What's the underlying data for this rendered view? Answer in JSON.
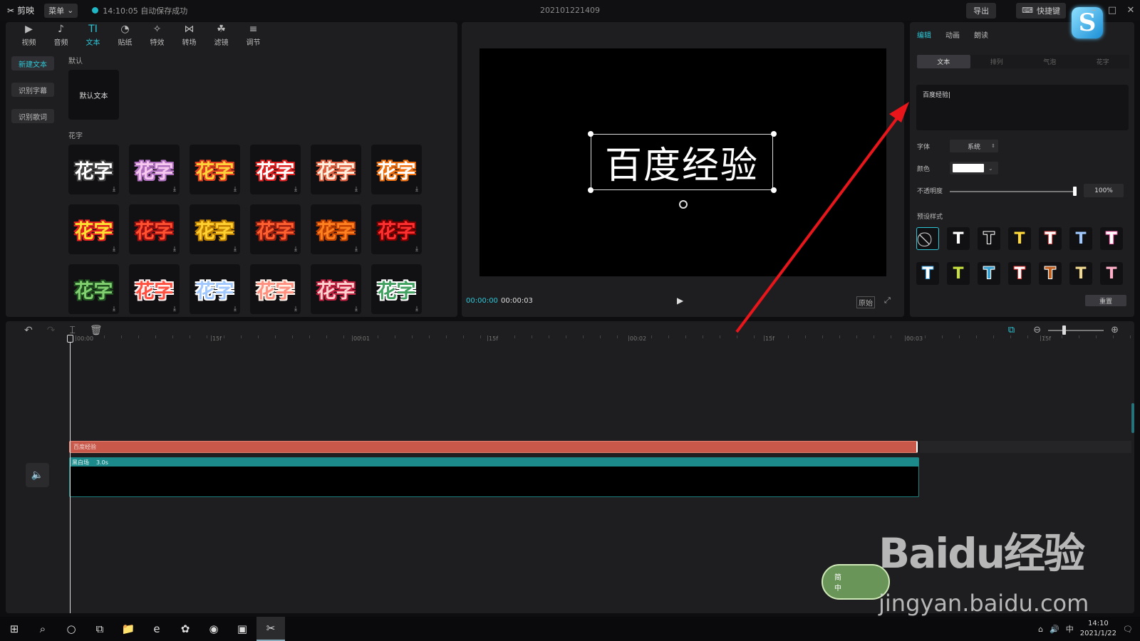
{
  "titlebar": {
    "app_name": "剪映",
    "menu_label": "菜单",
    "autosave": "14:10:05 自动保存成功",
    "project_title": "202101221409",
    "export_label": "导出",
    "shortcut_label": "快捷键"
  },
  "toolbar": {
    "items": [
      {
        "label": "视频",
        "icon": "▶"
      },
      {
        "label": "音频",
        "icon": "♪"
      },
      {
        "label": "文本",
        "icon": "TI"
      },
      {
        "label": "贴纸",
        "icon": "◔"
      },
      {
        "label": "特效",
        "icon": "✧"
      },
      {
        "label": "转场",
        "icon": "⋈"
      },
      {
        "label": "滤镜",
        "icon": "☘"
      },
      {
        "label": "调节",
        "icon": "≡"
      }
    ]
  },
  "sidebar": {
    "items": [
      "新建文本",
      "识别字幕",
      "识别歌词"
    ]
  },
  "library": {
    "default_section": "默认",
    "default_card": "默认文本",
    "huazi_section": "花字",
    "huazi": [
      {
        "label": "花字",
        "color": "#ffffff",
        "stroke": "#444444"
      },
      {
        "label": "花字",
        "color": "#f6c8f0",
        "stroke": "#b070c0"
      },
      {
        "label": "花字",
        "color": "#ffd23a",
        "stroke": "#e04020"
      },
      {
        "label": "花字",
        "color": "#ffffff",
        "stroke": "#e02020"
      },
      {
        "label": "花字",
        "color": "#fff0e0",
        "stroke": "#e06040"
      },
      {
        "label": "花字",
        "color": "#ffffff",
        "stroke": "#f07010"
      },
      {
        "label": "花字",
        "color": "#ffe030",
        "stroke": "#e02020"
      },
      {
        "label": "花字",
        "color": "#ff5030",
        "stroke": "#a01010"
      },
      {
        "label": "花字",
        "color": "#ffd030",
        "stroke": "#c08000"
      },
      {
        "label": "花字",
        "color": "#ff6030",
        "stroke": "#a02010"
      },
      {
        "label": "花字",
        "color": "#ff8020",
        "stroke": "#c04000"
      },
      {
        "label": "花字",
        "color": "#ff3030",
        "stroke": "#800000"
      },
      {
        "label": "花字",
        "color": "#80d070",
        "stroke": "#205020"
      },
      {
        "label": "花字",
        "color": "#ff5040",
        "stroke": "#fff0f0"
      },
      {
        "label": "花字",
        "color": "#a0c8ff",
        "stroke": "#ffffff"
      },
      {
        "label": "花字",
        "color": "#ff9080",
        "stroke": "#fff0e8"
      },
      {
        "label": "花字",
        "color": "#ffd0d0",
        "stroke": "#c02040"
      },
      {
        "label": "花字",
        "color": "#40a060",
        "stroke": "#ffffff"
      }
    ]
  },
  "preview": {
    "canvas_text": "百度经验",
    "time_current": "00:00:00",
    "time_total": "00:00:03",
    "ratio_label": "原始"
  },
  "inspector": {
    "tabs": [
      "编辑",
      "动画",
      "朗读"
    ],
    "subtabs": [
      "文本",
      "排列",
      "气泡",
      "花字"
    ],
    "text_value": "百度经验",
    "font_label": "字体",
    "font_value": "系统",
    "color_label": "颜色",
    "color_value": "#ffffff",
    "opacity_label": "不透明度",
    "opacity_value": "100%",
    "opacity_level": 1.0,
    "preset_label": "预设样式",
    "reset_label": "重置",
    "presets": [
      {
        "label": "⃠",
        "color": "#cccccc",
        "stroke": "#111113"
      },
      {
        "label": "T",
        "color": "#ffffff",
        "stroke": "#111113"
      },
      {
        "label": "T",
        "color": "#111113",
        "stroke": "#ffffff"
      },
      {
        "label": "T",
        "color": "#ffd83a",
        "stroke": "#111113"
      },
      {
        "label": "T",
        "color": "#ffffff",
        "stroke": "#e05050"
      },
      {
        "label": "T",
        "color": "#9fc8ff",
        "stroke": "#111113"
      },
      {
        "label": "T",
        "color": "#ffffff",
        "stroke": "#ff69b4"
      },
      {
        "label": "T",
        "color": "#ffffff",
        "stroke": "#3aa0e0"
      },
      {
        "label": "T",
        "color": "#c8e040",
        "stroke": "#111113"
      },
      {
        "label": "T",
        "color": "#3aa0d0",
        "stroke": "#ffffff"
      },
      {
        "label": "T",
        "color": "#ffffff",
        "stroke": "#e03030"
      },
      {
        "label": "T",
        "color": "#c06020",
        "stroke": "#ffffff"
      },
      {
        "label": "T",
        "color": "#f0d890",
        "stroke": "#111113"
      },
      {
        "label": "T",
        "color": "#ffb0c8",
        "stroke": "#111113"
      }
    ]
  },
  "timeline": {
    "ruler": [
      "00:00",
      "15f",
      "00:01",
      "15f",
      "00:02",
      "15f",
      "00:03",
      "15f"
    ],
    "text_clip": "百度经验",
    "video_clip_name": "黑白场",
    "video_clip_duration": "3.0s"
  },
  "watermark": {
    "brand": "Baidu经验",
    "url": "jingyan.baidu.com",
    "badge_top": "简",
    "badge_bottom": "中"
  },
  "taskbar": {
    "time": "14:10",
    "date": "2021/1/22",
    "ime": "中",
    "apps": [
      "⊞",
      "⌕",
      "○",
      "⧉",
      "📁",
      "e",
      "✿",
      "◉",
      "▣",
      "✂"
    ]
  }
}
